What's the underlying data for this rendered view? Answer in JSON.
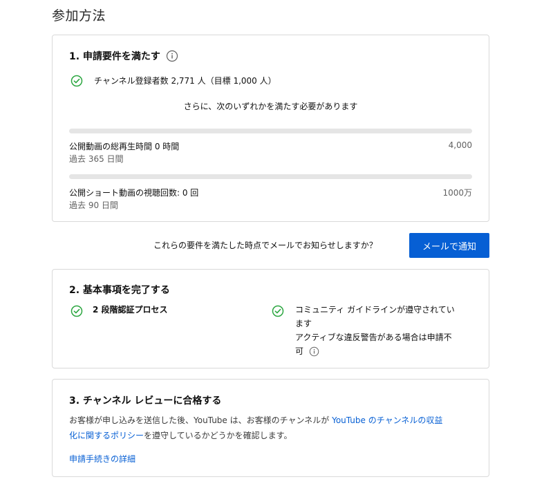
{
  "page": {
    "title": "参加方法"
  },
  "section1": {
    "title": "1. 申請要件を満たす",
    "subscribers_text": "チャンネル登録者数 2,771 人（目標 1,000 人）",
    "either_text": "さらに、次のいずれかを満たす必要があります",
    "watch_hours": {
      "label": "公開動画の総再生時間 0 時間",
      "period": "過去 365 日間",
      "goal": "4,000",
      "progress_fraction": 0
    },
    "shorts_views": {
      "label": "公開ショート動画の視聴回数: 0 回",
      "period": "過去 90 日間",
      "goal": "1000万",
      "progress_fraction": 0
    }
  },
  "notify": {
    "text": "これらの要件を満たした時点でメールでお知らせしますか？",
    "button_label": "メールで通知"
  },
  "section2": {
    "title": "2. 基本事項を完了する",
    "item1": "2 段階認証プロセス",
    "item2_line1": "コミュニティ ガイドラインが遵守されてい",
    "item2_line2": "ます",
    "item2_note_line1": "アクティブな違反警告がある場合は申請不",
    "item2_note_line2": "可"
  },
  "section3": {
    "title": "3. チャンネル レビューに合格する",
    "text_before": "お客様が申し込みを送信した後、YouTube は、お客様のチャンネルが ",
    "policy_link_line1": "YouTube のチャンネルの収益",
    "policy_link_line2": "化に関するポリシー",
    "text_after": "を遵守しているかどうかを確認します。",
    "details_link": "申請手続きの詳細"
  },
  "colors": {
    "accent": "#065fd4",
    "check_green": "#2ba640",
    "bar_track": "#e5e5e5",
    "muted_text": "#606060"
  },
  "icons": {
    "check": "check-circle-icon",
    "info": "info-icon"
  }
}
